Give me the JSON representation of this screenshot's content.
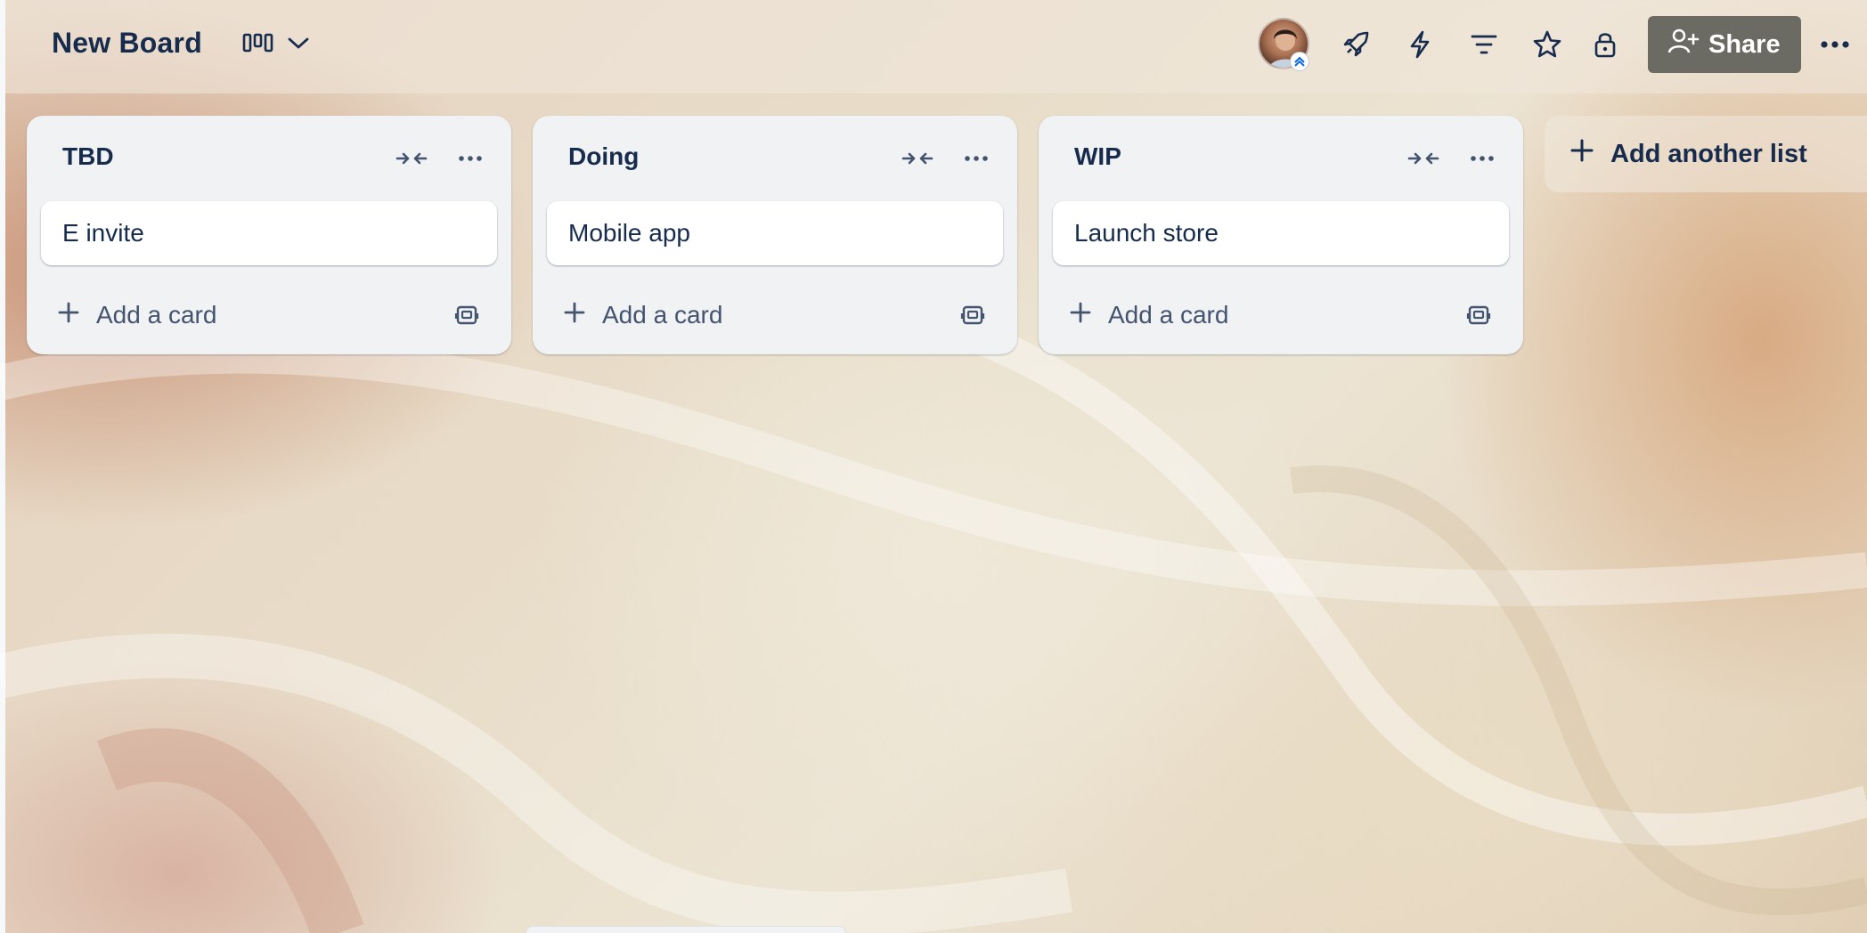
{
  "board": {
    "title": "New Board",
    "view_icon": "board-columns-icon"
  },
  "header": {
    "icons": [
      "rocket-icon",
      "lightning-icon",
      "filter-icon",
      "star-icon",
      "lock-icon",
      "more-icon"
    ],
    "share_label": "Share"
  },
  "lists": [
    {
      "title": "TBD",
      "cards": [
        "E invite"
      ],
      "add_card_label": "Add a card"
    },
    {
      "title": "Doing",
      "cards": [
        "Mobile app"
      ],
      "add_card_label": "Add a card"
    },
    {
      "title": "WIP",
      "cards": [
        "Launch store"
      ],
      "add_card_label": "Add a card"
    }
  ],
  "add_list_label": "Add another list",
  "colors": {
    "text": "#172b4d",
    "subtle_text": "#44546f",
    "list_bg": "#f1f2f4",
    "share_bg": "#6b6a63"
  }
}
